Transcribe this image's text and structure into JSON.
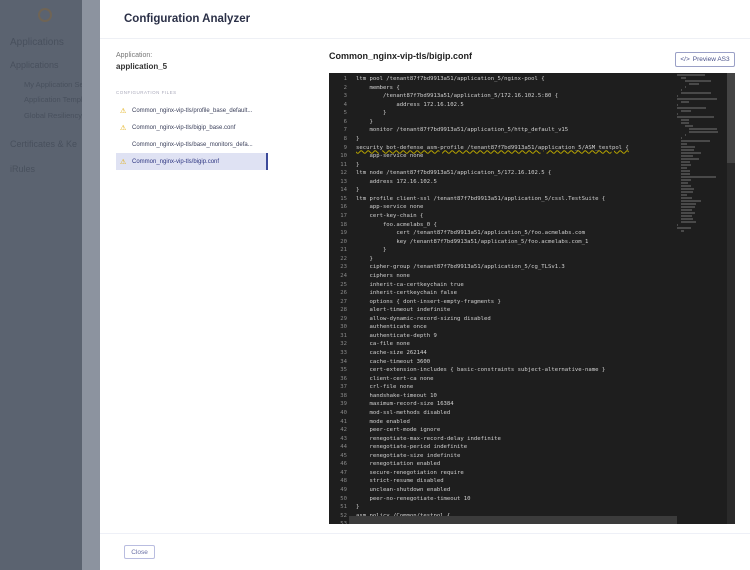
{
  "background": {
    "section": "Applications",
    "items": [
      "Applications",
      "My Application Se",
      "Application Templa",
      "Global Resiliency",
      "Certificates & Ke",
      "iRules"
    ]
  },
  "modal": {
    "title": "Configuration Analyzer",
    "app_label": "Application:",
    "app_name": "application_5",
    "files_header": "CONFIGURATION FILES",
    "files": [
      {
        "name": "Common_nginx-vip-tls/profile_base_default...",
        "warning": true
      },
      {
        "name": "Common_nginx-vip-tls/bigip_base.conf",
        "warning": true
      },
      {
        "name": "Common_nginx-vip-tls/base_monitors_defa...",
        "warning": false
      },
      {
        "name": "Common_nginx-vip-tls/bigip.conf",
        "warning": true,
        "selected": true
      }
    ],
    "content_title": "Common_nginx-vip-tls/bigip.conf",
    "preview_button": "Preview AS3",
    "preview_icon": "code-icon",
    "close_button": "Close"
  },
  "code": [
    "ltm pool /tenant87f7bd9913a51/application_5/nginx-pool {",
    "    members {",
    "        /tenant87f7bd9913a51/application_5/172.16.102.5:80 {",
    "            address 172.16.102.5",
    "        }",
    "    }",
    "    monitor /tenant87f7bd9913a51/application_5/http_default_v15",
    "}",
    "security bot-defense asm-profile /tenant87f7bd9913a51/application_5/ASM_testpol {",
    "    app-service none",
    "}",
    "ltm node /tenant87f7bd9913a51/application_5/172.16.102.5 {",
    "    address 172.16.102.5",
    "}",
    "ltm profile client-ssl /tenant87f7bd9913a51/application_5/cssl.TestSuite {",
    "    app-service none",
    "    cert-key-chain {",
    "        foo.acmelabs_0 {",
    "            cert /tenant87f7bd9913a51/application_5/foo.acmelabs.com",
    "            key /tenant87f7bd9913a51/application_5/foo.acmelabs.com_1",
    "        }",
    "    }",
    "    cipher-group /tenant87f7bd9913a51/application_5/cg_TLSv1.3",
    "    ciphers none",
    "    inherit-ca-certkeychain true",
    "    inherit-certkeychain false",
    "    options { dont-insert-empty-fragments }",
    "    alert-timeout indefinite",
    "    allow-dynamic-record-sizing disabled",
    "    authenticate once",
    "    authenticate-depth 9",
    "    ca-file none",
    "    cache-size 262144",
    "    cache-timeout 3600",
    "    cert-extension-includes { basic-constraints subject-alternative-name }",
    "    client-cert-ca none",
    "    crl-file none",
    "    handshake-timeout 10",
    "    maximum-record-size 16384",
    "    mod-ssl-methods disabled",
    "    mode enabled",
    "    peer-cert-mode ignore",
    "    renegotiate-max-record-delay indefinite",
    "    renegotiate-period indefinite",
    "    renegotiate-size indefinite",
    "    renegotiation enabled",
    "    secure-renegotiation require",
    "    strict-resume disabled",
    "    unclean-shutdown enabled",
    "    peer-no-renegotiate-timeout 10",
    "}",
    "asm policy /Common/testpol {",
    "    active"
  ],
  "highlighted_line": 9
}
